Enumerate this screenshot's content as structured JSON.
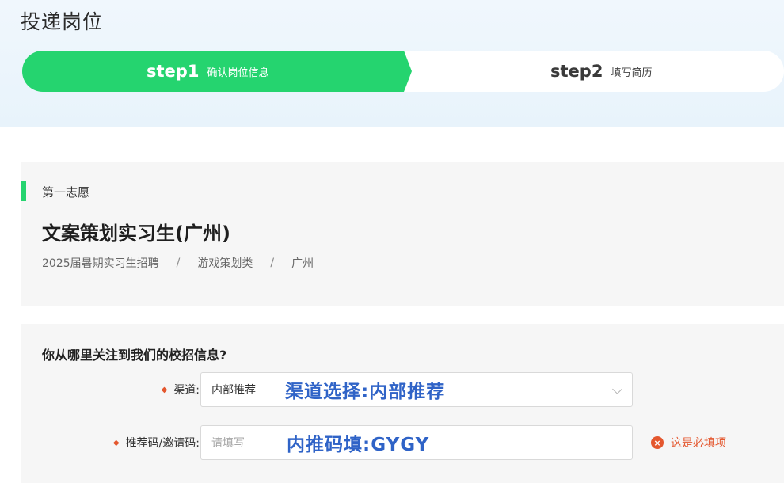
{
  "page": {
    "title": "投递岗位"
  },
  "stepper": {
    "steps": [
      {
        "num": "step1",
        "label": "确认岗位信息",
        "active": true
      },
      {
        "num": "step2",
        "label": "填写简历",
        "active": false
      }
    ]
  },
  "colors": {
    "accent": "#25d46f",
    "annotation": "#2f63c7",
    "error": "#e4572e"
  },
  "job": {
    "wish_label": "第一志愿",
    "title": "文案策划实习生(广州)",
    "breadcrumb": [
      "2025届暑期实习生招聘",
      "游戏策划类",
      "广州"
    ],
    "separator": "/"
  },
  "form": {
    "question": "你从哪里关注到我们的校招信息?",
    "required_mark": "◆",
    "channel": {
      "label": "渠道:",
      "value": "内部推荐",
      "annotation": "渠道选择:内部推荐"
    },
    "referral": {
      "label": "推荐码/邀请码:",
      "placeholder": "请填写",
      "annotation": "内推码填:GYGY",
      "error": "这是必填项",
      "error_icon": "×"
    }
  }
}
